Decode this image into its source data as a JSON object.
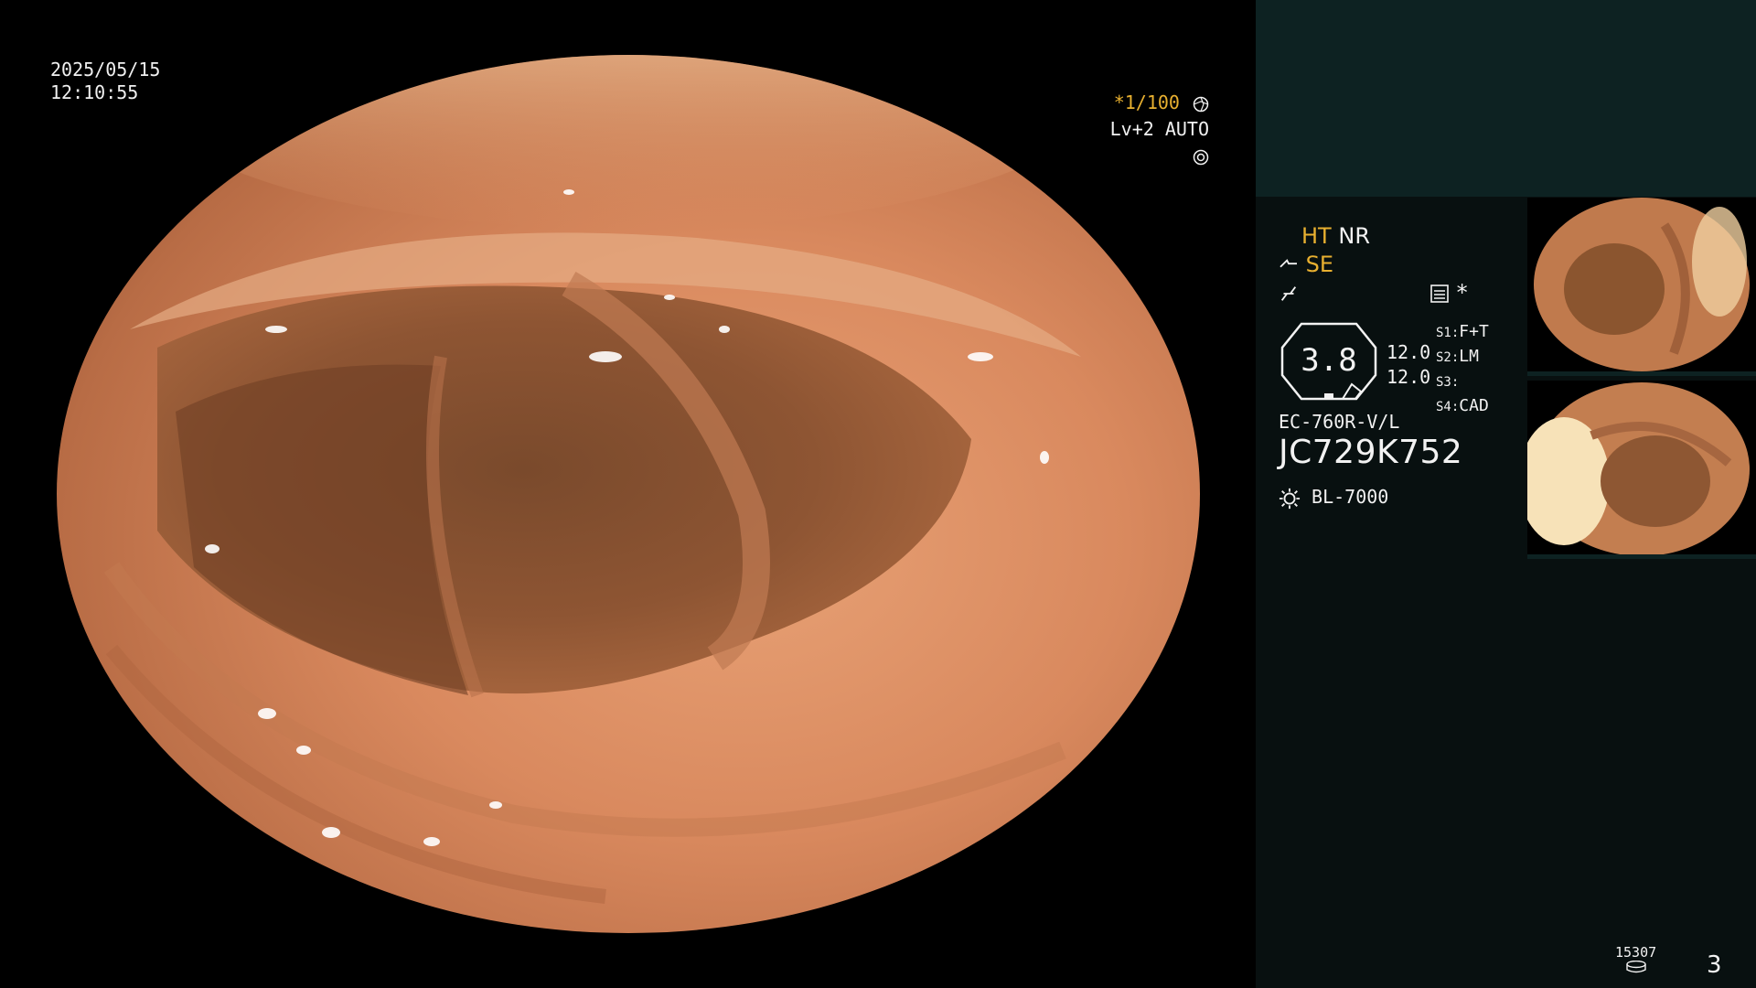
{
  "overlay": {
    "date": "2025/05/15",
    "time": "12:10:55",
    "shutter": "*1/100",
    "level_mode": "Lv+2 AUTO"
  },
  "panel": {
    "mode_ht": "HT",
    "mode_nr": "NR",
    "mode_se": "SE",
    "asterisk": "*",
    "gauge_value": "3.8",
    "gauge_top": "12.0",
    "gauge_bottom": "12.0",
    "s1_label": "S1:",
    "s1_value": "F+T",
    "s2_label": "S2:",
    "s2_value": "LM",
    "s3_label": "S3:",
    "s3_value": "",
    "s4_label": "S4:",
    "s4_value": "CAD",
    "model": "EC-760R-V/L",
    "serial": "JC729K752",
    "light_source": "BL-7000"
  },
  "footer": {
    "counter": "15307",
    "page": "3"
  },
  "colors": {
    "accent": "#e8b030",
    "panel_bg": "#081010",
    "panel_top_bg": "#0d2222"
  },
  "icons": [
    "aperture-icon",
    "iris-icon",
    "enhance-icon",
    "structure-icon",
    "lamp-icon",
    "capture-icon",
    "disk-icon"
  ]
}
